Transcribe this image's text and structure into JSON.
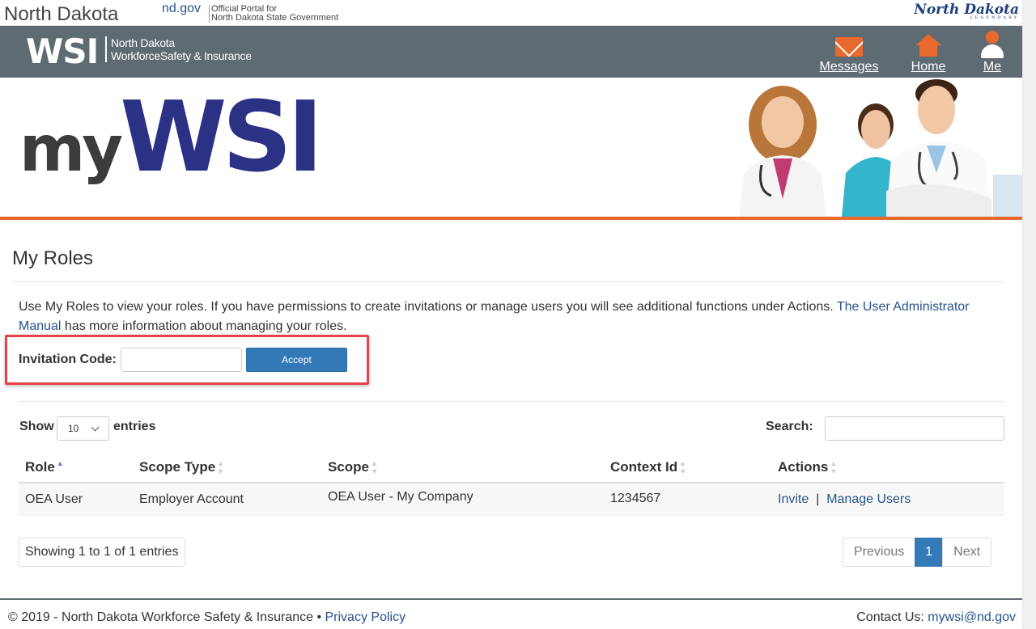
{
  "nd_bar": {
    "state_name": "North Dakota",
    "ndgov": "nd.gov",
    "portal_line1": "Official Portal for",
    "portal_line2": "North Dakota State Government",
    "legendary_logo": "North Dakota",
    "legendary_sub": "LEGENDARY"
  },
  "header": {
    "logo": "WSI",
    "org_line1": "North Dakota",
    "org_line2": "WorkforceSafety & Insurance",
    "nav": [
      {
        "label": "Messages",
        "icon": "envelope-icon"
      },
      {
        "label": "Home",
        "icon": "home-icon"
      },
      {
        "label": "Me",
        "icon": "person-icon"
      }
    ]
  },
  "banner": {
    "my": "my",
    "wsi": "WSI"
  },
  "page": {
    "title": "My Roles",
    "intro_text": "Use My Roles to view your roles. If you have permissions to create invitations or manage users you will see additional functions under Actions. ",
    "intro_link": "The User Administrator Manual",
    "intro_tail": " has more information about managing your roles."
  },
  "invitation": {
    "label": "Invitation Code:",
    "value": "",
    "button": "Accept"
  },
  "table_controls": {
    "show_label": "Show",
    "length_value": "10",
    "entries_label": "entries",
    "search_label": "Search:",
    "search_value": ""
  },
  "table": {
    "headers": [
      "Role",
      "Scope Type",
      "Scope",
      "Context Id",
      "Actions"
    ],
    "rows": [
      {
        "role": "OEA User",
        "scope_type": "Employer Account",
        "scope": "OEA User - My Company",
        "context_id": "1234567",
        "action_invite": "Invite",
        "action_sep": "|",
        "action_manage": "Manage Users"
      }
    ]
  },
  "pagination": {
    "info": "Showing 1 to 1 of 1 entries",
    "previous": "Previous",
    "current": "1",
    "next": "Next"
  },
  "footer": {
    "copyright": "© 2019 - North Dakota Workforce Safety & Insurance • ",
    "privacy": "Privacy Policy",
    "contact_label": "Contact Us: ",
    "contact_email": "mywsi@nd.gov"
  },
  "colors": {
    "header_bg": "#5f6b72",
    "accent_orange": "#e8692d",
    "brand_blue": "#2b3286",
    "link_blue": "#26548c",
    "button_blue": "#3379b7",
    "highlight_red": "#e8414a"
  }
}
